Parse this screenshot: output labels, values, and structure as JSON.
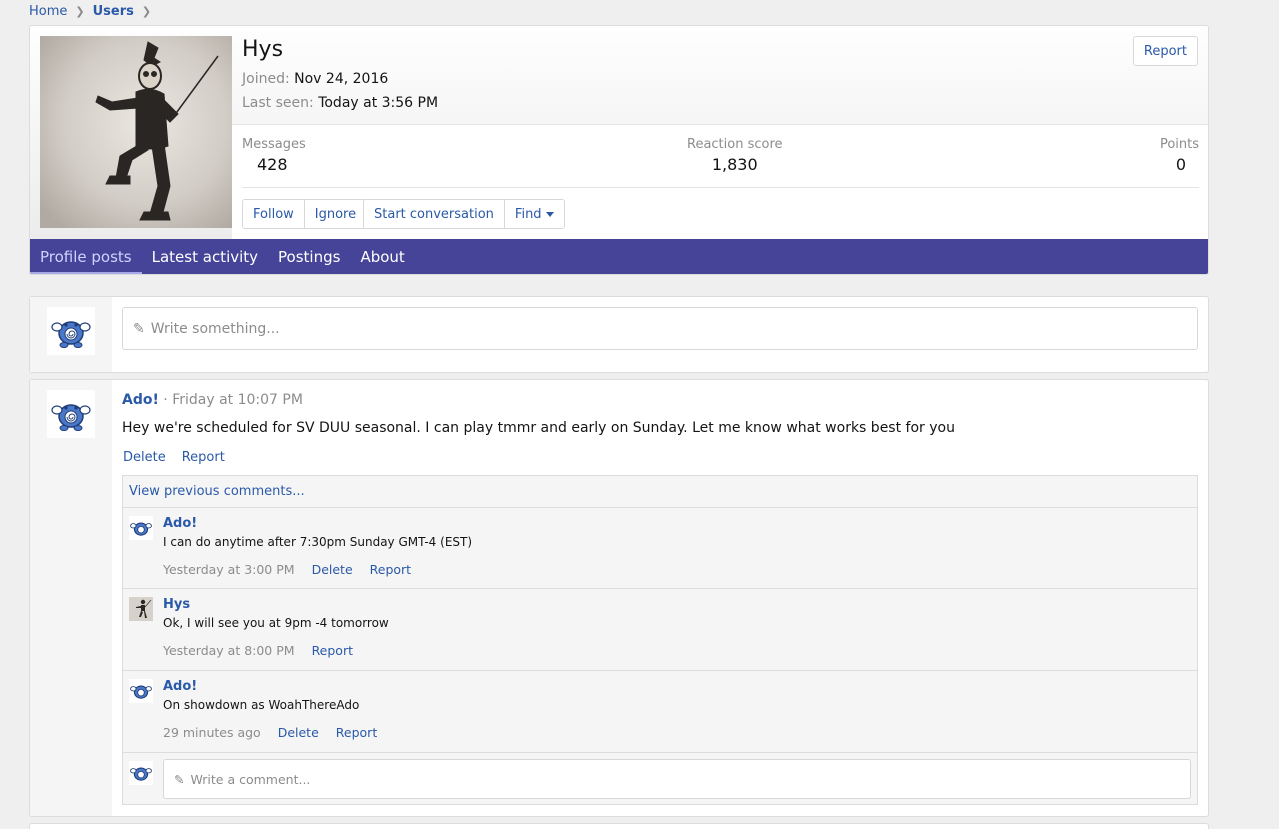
{
  "breadcrumb": {
    "home": "Home",
    "users": "Users"
  },
  "profile": {
    "username": "Hys",
    "joined_label": "Joined:",
    "joined_value": "Nov 24, 2016",
    "last_seen_label": "Last seen:",
    "last_seen_value": "Today at 3:56 PM",
    "report_label": "Report",
    "stats": {
      "messages_label": "Messages",
      "messages_value": "428",
      "reaction_label": "Reaction score",
      "reaction_value": "1,830",
      "points_label": "Points",
      "points_value": "0"
    },
    "buttons": {
      "follow": "Follow",
      "ignore": "Ignore",
      "start_conversation": "Start conversation",
      "find": "Find"
    }
  },
  "tabs": [
    "Profile posts",
    "Latest activity",
    "Postings",
    "About"
  ],
  "composer": {
    "placeholder": "Write something..."
  },
  "post": {
    "author": "Ado!",
    "time": "Friday at 10:07 PM",
    "separator": " · ",
    "body": "Hey we're scheduled for SV DUU seasonal. I can play tmmr and early on Sunday. Let me know what works best for you",
    "delete_label": "Delete",
    "report_label": "Report",
    "view_previous": "View previous comments...",
    "comments": [
      {
        "author": "Ado!",
        "text": "I can do anytime after 7:30pm Sunday GMT-4 (EST)",
        "time": "Yesterday at 3:00 PM",
        "delete": "Delete",
        "report": "Report"
      },
      {
        "author": "Hys",
        "text": "Ok, I will see you at 9pm -4 tomorrow",
        "time": "Yesterday at 8:00 PM",
        "report": "Report"
      },
      {
        "author": "Ado!",
        "text": "On showdown as WoahThereAdo",
        "time": "29 minutes ago",
        "delete": "Delete",
        "report": "Report"
      }
    ],
    "reply_placeholder": "Write a comment..."
  },
  "colors": {
    "accent": "#454499",
    "link": "#2a59a8",
    "muted": "#8c8c8c"
  }
}
